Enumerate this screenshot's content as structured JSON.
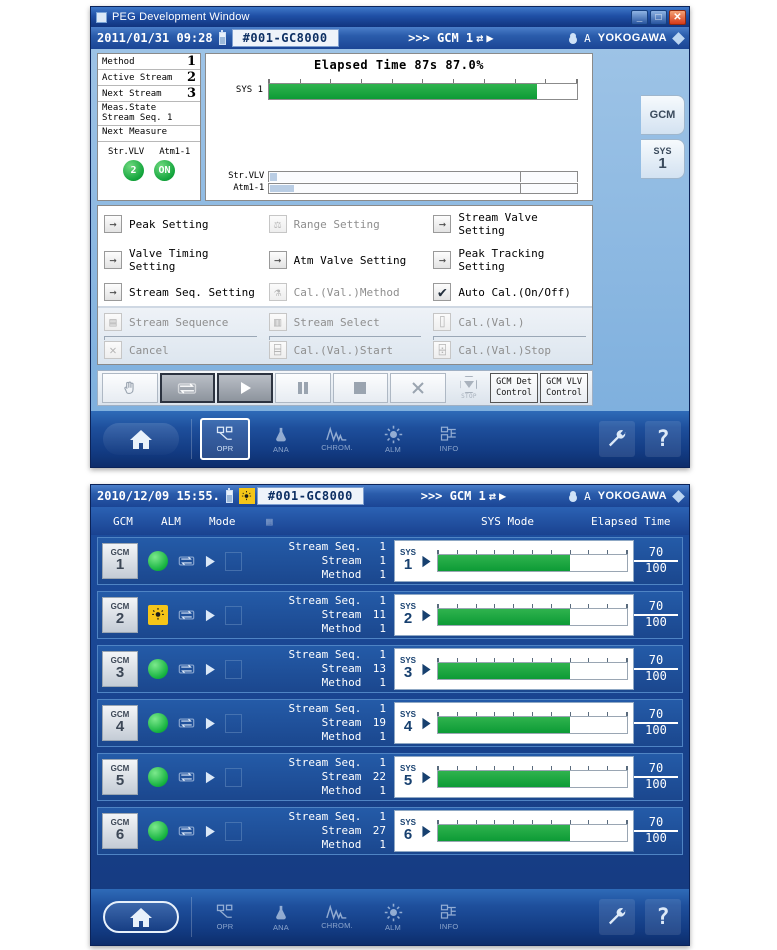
{
  "window1": {
    "title": "PEG Development Window",
    "window_buttons": [
      "minimize",
      "maximize",
      "close"
    ],
    "header": {
      "datetime": "2011/01/31 09:28",
      "device": "#001-GC8000",
      "selector": ">>> GCM 1",
      "user_letter": "A",
      "brand": "YOKOGAWA"
    },
    "left_panel": {
      "rows": [
        {
          "label": "Method",
          "value": "1"
        },
        {
          "label": "Active Stream",
          "value": "2"
        },
        {
          "label": "Next Stream",
          "value": "3"
        }
      ],
      "meas_state_line1": "Meas.State",
      "meas_state_line2": "Stream Seq. 1",
      "next_measure": "Next Measure",
      "valve_labels": [
        "Str.VLV",
        "Atm1-1"
      ],
      "valve_values": [
        "2",
        "ON"
      ]
    },
    "graph": {
      "title": "Elapsed Time  87s  87.0%",
      "sys_label": "SYS 1",
      "progress_percent": 87,
      "timeline_labels": [
        "Str.VLV",
        "Atm1-1"
      ],
      "timeline_fills": [
        7,
        24
      ]
    },
    "menu_upper": [
      {
        "label": "Peak Setting",
        "icon": "arrow-right-icon",
        "enabled": true
      },
      {
        "label": "Range Setting",
        "icon": "range-icon",
        "enabled": false
      },
      {
        "label": "Stream Valve Setting",
        "icon": "arrow-right-icon",
        "enabled": true
      },
      {
        "label": "Valve Timing Setting",
        "icon": "arrow-right-icon",
        "enabled": true
      },
      {
        "label": "Atm Valve Setting",
        "icon": "arrow-right-icon",
        "enabled": true
      },
      {
        "label": "Peak Tracking Setting",
        "icon": "arrow-right-icon",
        "enabled": true
      },
      {
        "label": "Stream Seq. Setting",
        "icon": "arrow-right-icon",
        "enabled": true
      },
      {
        "label": "Cal.(Val.)Method",
        "icon": "calibration-icon",
        "enabled": false
      },
      {
        "label": "Auto Cal.(On/Off)",
        "icon": "check-icon",
        "enabled": true
      }
    ],
    "menu_lower": [
      {
        "label": "Stream Sequence",
        "icon": "stream-sequence-icon",
        "enabled": false
      },
      {
        "label": "Stream Select",
        "icon": "stream-select-icon",
        "enabled": false
      },
      {
        "label": "Cal.(Val.)",
        "icon": "cal-icon",
        "enabled": false
      },
      {
        "label": "Cancel",
        "icon": "cancel-icon",
        "enabled": false
      },
      {
        "label": "Cal.(Val.)Start",
        "icon": "cal-start-icon",
        "enabled": false
      },
      {
        "label": "Cal.(Val.)Stop",
        "icon": "cal-stop-icon",
        "enabled": false
      }
    ],
    "control_toolbar": {
      "buttons": [
        {
          "name": "hand-icon",
          "selected": false
        },
        {
          "name": "cycle-icon",
          "selected": true
        },
        {
          "name": "play-icon",
          "selected": true
        },
        {
          "name": "pause-icon",
          "selected": false
        },
        {
          "name": "stop-square-icon",
          "selected": false
        },
        {
          "name": "close-x-icon",
          "selected": false
        }
      ],
      "emergency_label": "STOP",
      "wide_buttons": [
        {
          "line1": "GCM Det",
          "line2": "Control"
        },
        {
          "line1": "GCM VLV",
          "line2": "Control"
        }
      ]
    },
    "right_tabs": [
      {
        "label": "GCM",
        "sub": ""
      },
      {
        "label": "SYS",
        "sub": "1"
      }
    ],
    "navbar": {
      "home": "home-icon",
      "items": [
        {
          "label": "OPR",
          "selected": true
        },
        {
          "label": "ANA",
          "selected": false
        },
        {
          "label": "CHROM.",
          "selected": false
        },
        {
          "label": "ALM",
          "selected": false
        },
        {
          "label": "INFO",
          "selected": false
        }
      ],
      "right": [
        "wrench-icon",
        "?"
      ],
      "home_selected": false
    }
  },
  "window2": {
    "header": {
      "datetime": "2010/12/09 15:55.",
      "device": "#001-GC8000",
      "selector": ">>> GCM 1",
      "user_letter": "A",
      "brand": "YOKOGAWA",
      "alarm_flag": true
    },
    "columns": {
      "gcm": "GCM",
      "alm": "ALM",
      "mode": "Mode",
      "sys_mode": "SYS Mode",
      "elapsed_time": "Elapsed Time"
    },
    "labels": {
      "stream_seq": "Stream Seq.",
      "stream": "Stream",
      "method": "Method",
      "sys": "SYS"
    },
    "rows": [
      {
        "gcm": "1",
        "alarm": false,
        "stream_seq": "1",
        "stream": "1",
        "method": "1",
        "sys": "1",
        "progress": 70,
        "max": "100",
        "value": "70"
      },
      {
        "gcm": "2",
        "alarm": true,
        "stream_seq": "1",
        "stream": "11",
        "method": "1",
        "sys": "2",
        "progress": 70,
        "max": "100",
        "value": "70"
      },
      {
        "gcm": "3",
        "alarm": false,
        "stream_seq": "1",
        "stream": "13",
        "method": "1",
        "sys": "3",
        "progress": 70,
        "max": "100",
        "value": "70"
      },
      {
        "gcm": "4",
        "alarm": false,
        "stream_seq": "1",
        "stream": "19",
        "method": "1",
        "sys": "4",
        "progress": 70,
        "max": "100",
        "value": "70"
      },
      {
        "gcm": "5",
        "alarm": false,
        "stream_seq": "1",
        "stream": "22",
        "method": "1",
        "sys": "5",
        "progress": 70,
        "max": "100",
        "value": "70"
      },
      {
        "gcm": "6",
        "alarm": false,
        "stream_seq": "1",
        "stream": "27",
        "method": "1",
        "sys": "6",
        "progress": 70,
        "max": "100",
        "value": "70"
      }
    ],
    "navbar": {
      "home": "home-icon",
      "items": [
        {
          "label": "OPR",
          "selected": false
        },
        {
          "label": "ANA",
          "selected": false
        },
        {
          "label": "CHROM.",
          "selected": false
        },
        {
          "label": "ALM",
          "selected": false
        },
        {
          "label": "INFO",
          "selected": false
        }
      ],
      "right": [
        "wrench-icon",
        "?"
      ],
      "home_selected": true
    }
  },
  "colors": {
    "accent_blue": "#1b4595",
    "green_status": "#12a43b",
    "alarm_yellow": "#f5c518",
    "panel_blue": "#9dc3e6"
  }
}
